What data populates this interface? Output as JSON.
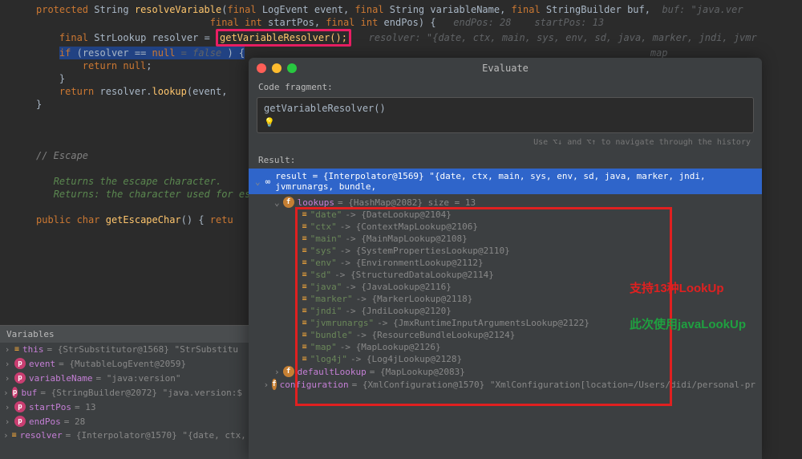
{
  "code": {
    "l1_kw1": "protected",
    "l1_type": "String",
    "l1_fn": "resolveVariable",
    "l1_p1kw": "final",
    "l1_p1t": "LogEvent",
    "l1_p1n": "event",
    "l1_p2kw": "final",
    "l1_p2t": "String",
    "l1_p2n": "variableName",
    "l1_p3kw": "final",
    "l1_p3t": "StringBuilder",
    "l1_p3n": "buf",
    "l1_hint": "buf: \"java.ver",
    "l2_kw": "final int",
    "l2_n1": "startPos",
    "l2_kw2": "final int",
    "l2_n2": "endPos",
    "l2_h1": "endPos: 28",
    "l2_h2": "startPos: 13",
    "l3_kw": "final",
    "l3_t": "StrLookup",
    "l3_n": "resolver",
    "l3_eq": "=",
    "l3_call": "getVariableResolver();",
    "l3_hint": "resolver: \"{date, ctx, main, sys, env, sd, java, marker, jndi, jvmr",
    "l4_kw": "if",
    "l4_cond": "(resolver == ",
    "l4_null": "null",
    "l4_h": " = false",
    "l4_close": " ) {",
    "l4_hint": "map",
    "l5_kw": "return null",
    "l5_semi": ";",
    "l6": "}",
    "l7_kw": "return",
    "l7_n": " resolver.",
    "l7_fn": "lookup",
    "l7_args": "(event,",
    "l8": "}",
    "l9_c": "// Escape",
    "l10_d": "Returns the escape character.",
    "l11_d": "Returns: the character used for escaping",
    "l12_kw": "public char",
    "l12_fn": "getEscapeChar",
    "l12_rest": "() { ",
    "l12_ret": "retu"
  },
  "vars": {
    "header": "Variables",
    "items": [
      {
        "icon": "eq",
        "name": "this",
        "val": " = {StrSubstitutor@1568} \"StrSubstitu"
      },
      {
        "icon": "p",
        "name": "event",
        "val": " = {MutableLogEvent@2059}"
      },
      {
        "icon": "p",
        "name": "variableName",
        "val": " = \"java:version\""
      },
      {
        "icon": "p",
        "name": "buf",
        "val": " = {StringBuilder@2072} \"java.version:$"
      },
      {
        "icon": "p",
        "name": "startPos",
        "val": " = 13"
      },
      {
        "icon": "p",
        "name": "endPos",
        "val": " = 28"
      },
      {
        "icon": "eq",
        "name": "resolver",
        "val": " = {Interpolator@1570} \"{date, ctx,"
      }
    ]
  },
  "dialog": {
    "title": "Evaluate",
    "fragLabel": "Code fragment:",
    "fragCode": "getVariableResolver()",
    "navHint": "Use ⌥↓ and ⌥↑ to navigate through the history",
    "resultLabel": "Result:",
    "resultHdr": "result = {Interpolator@1569} \"{date, ctx, main, sys, env, sd, java, marker, jndi, jvmrunargs, bundle,",
    "lookups": {
      "name": "lookups",
      "val": " = {HashMap@2082}  size = 13"
    },
    "entries": [
      {
        "k": "\"date\"",
        "v": " -> {DateLookup@2104}"
      },
      {
        "k": "\"ctx\"",
        "v": " -> {ContextMapLookup@2106}"
      },
      {
        "k": "\"main\"",
        "v": " -> {MainMapLookup@2108}"
      },
      {
        "k": "\"sys\"",
        "v": " -> {SystemPropertiesLookup@2110}"
      },
      {
        "k": "\"env\"",
        "v": " -> {EnvironmentLookup@2112}"
      },
      {
        "k": "\"sd\"",
        "v": " -> {StructuredDataLookup@2114}"
      },
      {
        "k": "\"java\"",
        "v": " -> {JavaLookup@2116}"
      },
      {
        "k": "\"marker\"",
        "v": " -> {MarkerLookup@2118}"
      },
      {
        "k": "\"jndi\"",
        "v": " -> {JndiLookup@2120}"
      },
      {
        "k": "\"jvmrunargs\"",
        "v": " -> {JmxRuntimeInputArgumentsLookup@2122}"
      },
      {
        "k": "\"bundle\"",
        "v": " -> {ResourceBundleLookup@2124}"
      },
      {
        "k": "\"map\"",
        "v": " -> {MapLookup@2126}"
      },
      {
        "k": "\"log4j\"",
        "v": " -> {Log4jLookup@2128}"
      }
    ],
    "tail": [
      {
        "icon": "f",
        "name": "defaultLookup",
        "val": " = {MapLookup@2083}"
      },
      {
        "icon": "f",
        "name": "configuration",
        "val": " = {XmlConfiguration@1570} \"XmlConfiguration[location=/Users/didi/personal-pr"
      }
    ]
  },
  "annot": {
    "red": "支持13种LookUp",
    "green": "此次使用javaLookUp"
  }
}
